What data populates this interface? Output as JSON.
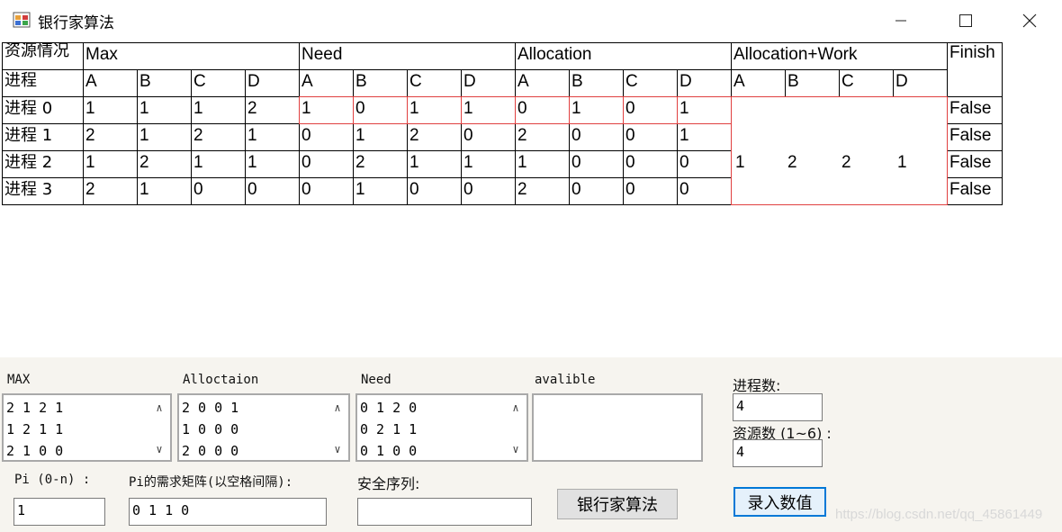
{
  "window": {
    "title": "银行家算法",
    "minimize_glyph": "—",
    "maximize_glyph": "☐",
    "close_glyph": "✕"
  },
  "table": {
    "corner_top": "资源情况",
    "corner_bottom": "进程",
    "groups": [
      "Max",
      "Need",
      "Allocation",
      "Allocation+Work"
    ],
    "finish_header": "Finish",
    "resources": [
      "A",
      "B",
      "C",
      "D"
    ],
    "rows": [
      {
        "process": "进程 0",
        "max": [
          "1",
          "1",
          "1",
          "2"
        ],
        "need": [
          "1",
          "0",
          "1",
          "1"
        ],
        "allocation": [
          "0",
          "1",
          "0",
          "1"
        ],
        "finish": "False"
      },
      {
        "process": "进程 1",
        "max": [
          "2",
          "1",
          "2",
          "1"
        ],
        "need": [
          "0",
          "1",
          "2",
          "0"
        ],
        "allocation": [
          "2",
          "0",
          "0",
          "1"
        ],
        "finish": "False"
      },
      {
        "process": "进程 2",
        "max": [
          "1",
          "2",
          "1",
          "1"
        ],
        "need": [
          "0",
          "2",
          "1",
          "1"
        ],
        "allocation": [
          "1",
          "0",
          "0",
          "0"
        ],
        "finish": "False"
      },
      {
        "process": "进程 3",
        "max": [
          "2",
          "1",
          "0",
          "0"
        ],
        "need": [
          "0",
          "1",
          "0",
          "0"
        ],
        "allocation": [
          "2",
          "0",
          "0",
          "0"
        ],
        "finish": "False"
      }
    ],
    "work": [
      "1",
      "2",
      "2",
      "1"
    ]
  },
  "inputs": {
    "max_label": "MAX",
    "max_lines": [
      "2 1 2 1",
      "1 2 1 1",
      "2 1 0 0"
    ],
    "alloc_label": "Alloctaion",
    "alloc_lines": [
      "2 0 0 1",
      "1 0 0 0",
      "2 0 0 0"
    ],
    "need_label": "Need",
    "need_lines": [
      "0 1 2 0",
      "0 2 1 1",
      "0 1 0 0"
    ],
    "available_label": "avalible",
    "available_lines": [],
    "process_count_label": "进程数:",
    "process_count_value": "4",
    "resource_count_label": "资源数 (1~6) :",
    "resource_count_value": "4",
    "pi_label": "Pi (0-n) :",
    "pi_value": "1",
    "request_label": "Pi的需求矩阵(以空格间隔):",
    "request_value": "0 1 1 0",
    "safe_seq_label": "安全序列:",
    "safe_seq_value": "",
    "banker_button": "银行家算法",
    "enter_button": "录入数值",
    "scroll_up": "∧",
    "scroll_down": "∨"
  },
  "watermark": "https://blog.csdn.net/qq_45861449"
}
